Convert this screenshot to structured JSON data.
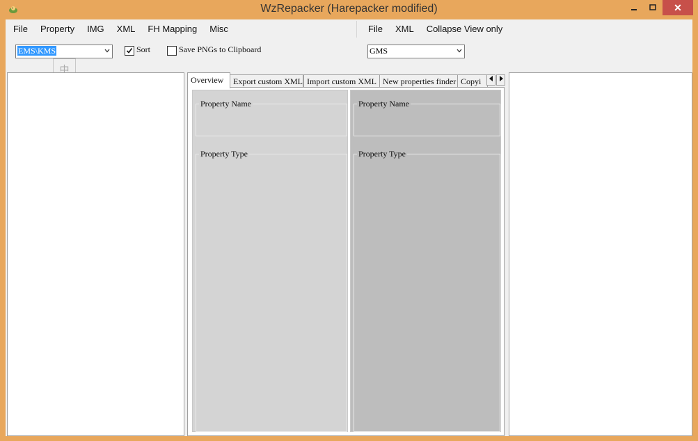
{
  "window": {
    "title": "WzRepacker (Harepacker modified)",
    "close_glyph": "✕",
    "ime_glyph": "中"
  },
  "menu_left": [
    "File",
    "Property",
    "IMG",
    "XML",
    "FH Mapping",
    "Misc"
  ],
  "menu_right": [
    "File",
    "XML",
    "Collapse View only"
  ],
  "toolbar": {
    "left_combo_value": "EMS\\KMS",
    "sort_label": "Sort",
    "sort_checked": true,
    "save_png_label": "Save PNGs to Clipboard",
    "save_png_checked": false,
    "right_combo_value": "GMS"
  },
  "tabs": [
    "Overview",
    "Export custom XML",
    "Import custom XML",
    "New properties finder",
    "Copyi"
  ],
  "active_tab": "Overview",
  "overview": {
    "left": {
      "name_label": "Property Name",
      "type_label": "Property Type"
    },
    "right": {
      "name_label": "Property Name",
      "type_label": "Property Type"
    }
  },
  "colors": {
    "titlebar": "#e8a75c",
    "close_button": "#c7504a",
    "pane_left": "#d4d4d4",
    "pane_right": "#bdbdbd",
    "selection": "#3399ff"
  }
}
